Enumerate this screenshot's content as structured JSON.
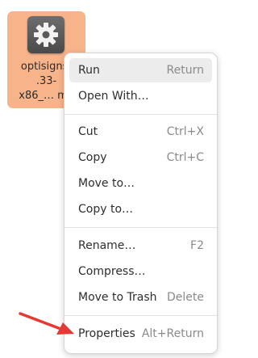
{
  "desktop_file": {
    "icon": "gear-icon",
    "name_lines": [
      "optisigns-",
      ".33-",
      "x86_… ma"
    ],
    "selected_color": "#f7b48b"
  },
  "context_menu": {
    "items": [
      {
        "label": "Run",
        "shortcut": "Return"
      },
      {
        "label": "Open With…",
        "shortcut": ""
      },
      {
        "label": "Cut",
        "shortcut": "Ctrl+X"
      },
      {
        "label": "Copy",
        "shortcut": "Ctrl+C"
      },
      {
        "label": "Move to…",
        "shortcut": ""
      },
      {
        "label": "Copy to…",
        "shortcut": ""
      },
      {
        "label": "Rename…",
        "shortcut": "F2"
      },
      {
        "label": "Compress…",
        "shortcut": ""
      },
      {
        "label": "Move to Trash",
        "shortcut": "Delete"
      },
      {
        "label": "Properties",
        "shortcut": "Alt+Return"
      }
    ],
    "highlighted_item": "Run"
  },
  "annotation": {
    "arrow_icon": "red-arrow-icon",
    "arrow_color": "#e53935",
    "points_to": "Properties"
  }
}
